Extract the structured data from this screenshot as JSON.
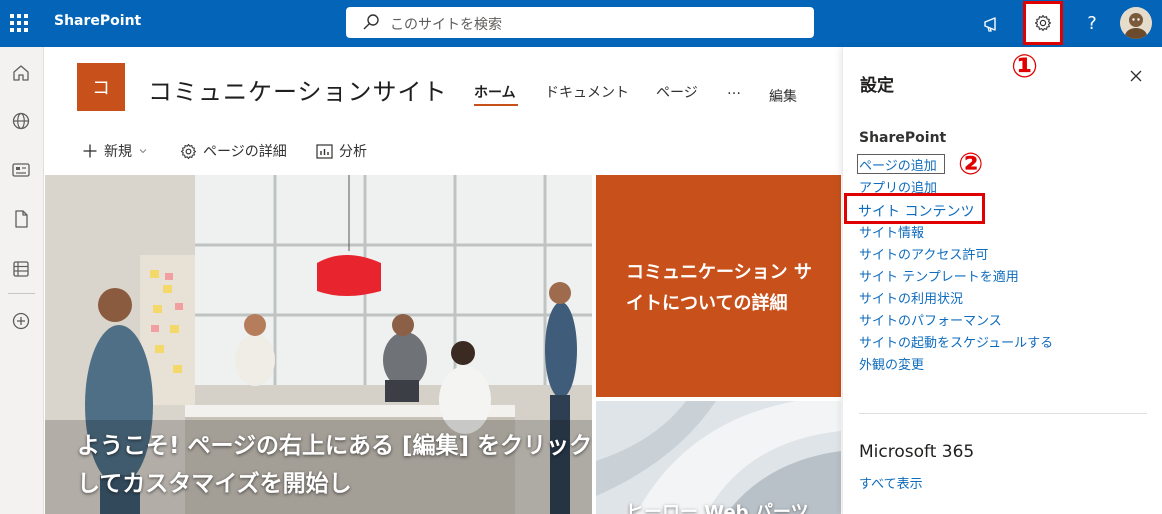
{
  "topbar": {
    "brand": "SharePoint",
    "search_placeholder": "このサイトを検索",
    "help_label": "?"
  },
  "site": {
    "logo_letter": "コ",
    "title": "コミュニケーションサイト",
    "nav": [
      "ホーム",
      "ドキュメント",
      "ページ",
      "…",
      "編集"
    ]
  },
  "commandbar": {
    "new_label": "新規",
    "page_details_label": "ページの詳細",
    "analytics_label": "分析"
  },
  "hero": {
    "main_caption": "ようこそ! ページの右上にある [編集] をクリックしてカスタマイズを開始し",
    "tile1_text": "コミュニケーション サイトについての詳細",
    "tile2_text": "ヒーロー Web パーツ"
  },
  "settings_panel": {
    "title": "設定",
    "sharepoint_heading": "SharePoint",
    "links": [
      "ページの追加",
      "アプリの追加",
      "サイト コンテンツ",
      "サイト情報",
      "サイトのアクセス許可",
      "サイト テンプレートを適用",
      "サイトの利用状況",
      "サイトのパフォーマンス",
      "サイトの起動をスケジュールする",
      "外観の変更"
    ],
    "m365_heading": "Microsoft 365",
    "m365_link": "すべて表示"
  },
  "annotations": {
    "marker1": "①",
    "marker2": "②"
  },
  "colors": {
    "suite_bar": "#0364b8",
    "accent": "#c8511b",
    "link": "#0f6cbd",
    "highlight": "#e00000"
  },
  "icons": [
    "waffle-icon",
    "search-icon",
    "megaphone-icon",
    "gear-icon",
    "help-icon",
    "home-icon",
    "globe-icon",
    "news-icon",
    "document-icon",
    "list-icon",
    "add-circle-icon",
    "close-icon",
    "plus-icon",
    "chevron-down-icon",
    "settings-icon",
    "chart-icon"
  ]
}
